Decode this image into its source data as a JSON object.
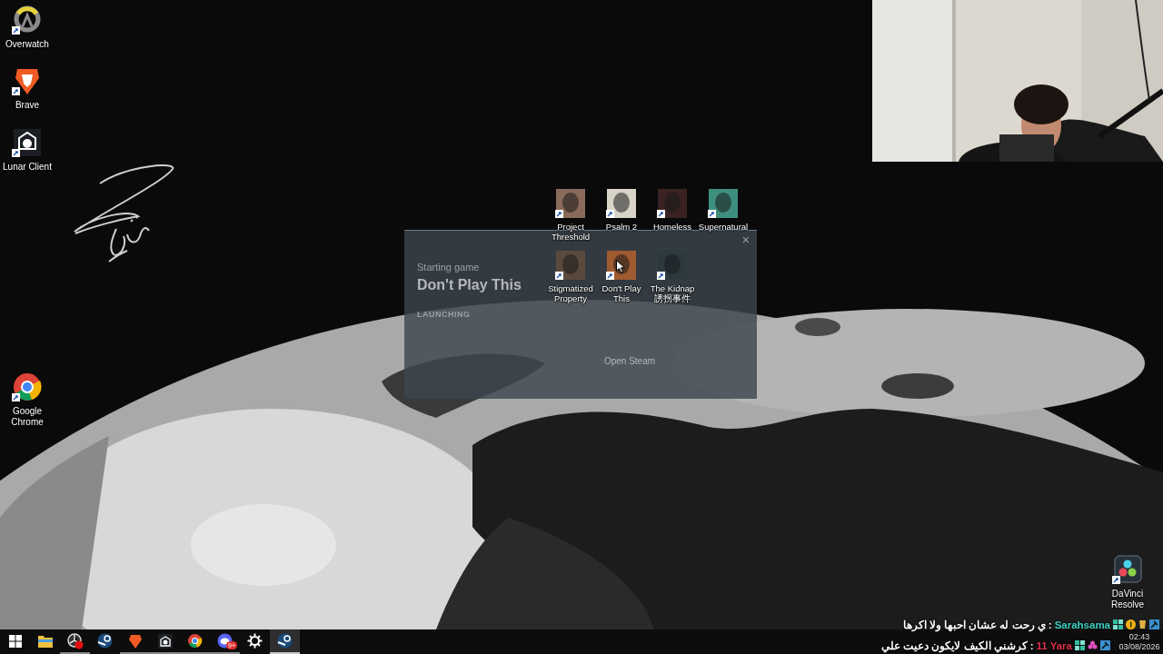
{
  "desktop_icons": [
    {
      "label": "Overwatch",
      "kind": "ring"
    },
    {
      "label": "Brave",
      "kind": "shield"
    },
    {
      "label": "Lunar Client",
      "kind": "moon"
    },
    {
      "label": "Google Chrome",
      "kind": "chrome"
    },
    {
      "label": "Project Threshold",
      "kind": "tile",
      "color": "#8a6a5a"
    },
    {
      "label": "Psalm 2",
      "kind": "tile",
      "color": "#d8d4c8"
    },
    {
      "label": "Homeless",
      "kind": "tile",
      "color": "#3a2222"
    },
    {
      "label": "Supernatural",
      "kind": "tile",
      "color": "#3f8f80"
    },
    {
      "label": "Stigmatized Property",
      "kind": "tile",
      "color": "#5a4a3e"
    },
    {
      "label": "Don't Play This",
      "kind": "tile",
      "color": "#a05a30"
    },
    {
      "label": "The Kidnap 誘拐事件",
      "kind": "tile",
      "color": "#2c3a40"
    },
    {
      "label": "DaVinci Resolve",
      "kind": "dots"
    }
  ],
  "launch_dialog": {
    "close": "×",
    "status": "Starting game",
    "game": "Don't Play This",
    "phase": "LAUNCHING",
    "button": "Open Steam"
  },
  "chat": [
    {
      "name": "Sarahsama",
      "color": "#3fd0c0",
      "separator": ":",
      "message": "ي رحت له عشان احبها ولا اكرها"
    },
    {
      "name": "11 Yara",
      "color": "#e0304a",
      "separator": ":",
      "message": "كرشني الكيف لايكون دعيت علي"
    }
  ],
  "taskbar": {
    "items": [
      {
        "kind": "windows",
        "running": false,
        "active": false
      },
      {
        "kind": "folder",
        "running": false,
        "active": false
      },
      {
        "kind": "record",
        "running": true,
        "active": false
      },
      {
        "kind": "steam",
        "running": false,
        "active": false
      },
      {
        "kind": "shield",
        "running": true,
        "active": false
      },
      {
        "kind": "moon",
        "running": true,
        "active": false
      },
      {
        "kind": "chrome",
        "running": true,
        "active": false
      },
      {
        "kind": "chat",
        "running": true,
        "active": false,
        "badge": "9+"
      },
      {
        "kind": "gear",
        "running": false,
        "active": false
      },
      {
        "kind": "steam",
        "running": true,
        "active": true
      }
    ],
    "clock": {
      "time": "02:43",
      "date": "03/08/2026"
    }
  }
}
